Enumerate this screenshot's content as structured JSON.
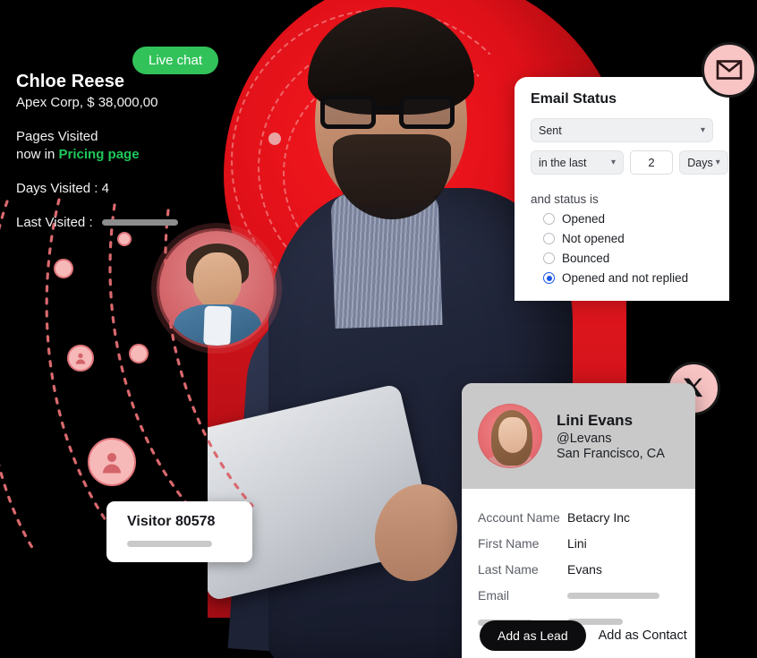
{
  "live_chat": {
    "label": "Live chat"
  },
  "visitor_profile": {
    "name": "Chloe Reese",
    "company_value": "Apex Corp, $ 38,000,00",
    "pages_visited_label": "Pages Visited",
    "now_in_prefix": "now in ",
    "now_in_page": "Pricing page",
    "days_visited": "Days Visited : 4",
    "last_visited_label": "Last Visited :",
    "accent_green": "#1fc85b"
  },
  "email_status": {
    "title": "Email Status",
    "status_select_value": "Sent",
    "timeframe_select_value": "in the last",
    "amount_value": "2",
    "unit_select_value": "Days",
    "and_status_is_label": "and status is",
    "options": [
      {
        "label": "Opened",
        "selected": false
      },
      {
        "label": "Not opened",
        "selected": false
      },
      {
        "label": "Bounced",
        "selected": false
      },
      {
        "label": "Opened and not replied",
        "selected": true
      }
    ],
    "selected_color": "#1a56e8"
  },
  "badges": {
    "mail_icon": "mail-icon",
    "x_icon": "x-twitter-icon",
    "badge_fill": "#f9c4c4"
  },
  "visitor_card": {
    "title": "Visitor 80578"
  },
  "lead_card": {
    "name": "Lini Evans",
    "handle": "@Levans",
    "location": "San Francisco, CA",
    "fields": [
      {
        "key": "Account Name",
        "value": "Betacry Inc"
      },
      {
        "key": "First Name",
        "value": "Lini"
      },
      {
        "key": "Last Name",
        "value": "Evans"
      },
      {
        "key": "Email",
        "value": ""
      }
    ],
    "primary_action": "Add as Lead",
    "secondary_action": "Add as Contact"
  }
}
